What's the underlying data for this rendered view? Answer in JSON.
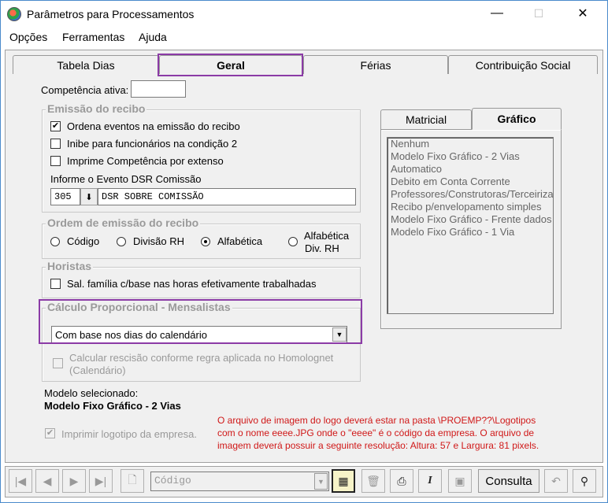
{
  "window": {
    "title": "Parâmetros para Processamentos",
    "min": "—",
    "max": "☐",
    "close": "✕"
  },
  "menu": [
    "Opções",
    "Ferramentas",
    "Ajuda"
  ],
  "tabs": [
    "Tabela Dias",
    "Geral",
    "Férias",
    "Contribuição Social"
  ],
  "active_tab": "Geral",
  "competencia": {
    "label": "Competência ativa:",
    "value": ""
  },
  "emissao": {
    "title": "Emissão do recibo",
    "options": [
      {
        "label": "Ordena eventos na emissão do recibo",
        "checked": true
      },
      {
        "label": "Inibe para funcionários na condição 2",
        "checked": false
      },
      {
        "label": "Imprime Competência por extenso",
        "checked": false
      }
    ],
    "dsr_label": "Informe o Evento DSR Comissão",
    "dsr_code": "305",
    "dsr_desc": "DSR SOBRE COMISSÃO"
  },
  "ordem": {
    "title": "Ordem de emissão do recibo",
    "options": [
      "Código",
      "Divisão RH",
      "Alfabética",
      "Alfabética",
      "Div. RH"
    ],
    "selected": "Alfabética"
  },
  "horistas": {
    "title": "Horistas",
    "option": "Sal. família c/base nas horas efetivamente trabalhadas",
    "checked": false
  },
  "calculo": {
    "title": "Cálculo Proporcional - Mensalistas",
    "selected": "Com base nos dias do calendário",
    "rescisao_line1": "Calcular rescisão conforme regra aplicada no Homolognet",
    "rescisao_line2": "(Calendário)"
  },
  "modelo": {
    "label": "Modelo selecionado:",
    "value": "Modelo Fixo Gráfico - 2 Vias"
  },
  "logotipo": {
    "label": "Imprimir logotipo da empresa.",
    "checked": true
  },
  "note": [
    "O arquivo de imagem do logo deverá estar na pasta \\PROEMP??\\Logotipos",
    "com o nome eeee.JPG onde o \"eeee\" é o código da empresa. O arquivo de",
    "imagem deverá possuir a seguinte resolução: Altura: 57 e Largura: 81 pixels."
  ],
  "side_tabs": [
    "Matricial",
    "Gráfico"
  ],
  "side_active": "Gráfico",
  "models": [
    "Nenhum",
    "Modelo Fixo Gráfico - 2 Vias",
    "Automatico",
    "Debito em Conta Corrente",
    "Professores/Construtoras/Terceiriza",
    "Recibo p/envelopamento simples",
    "Modelo Fixo Gráfico - Frente dados",
    "Modelo Fixo Gráfico - 1 Via"
  ],
  "toolbar": {
    "search_placeholder": "Código",
    "consulta": "Consulta"
  },
  "colors": {
    "highlight": "#8b3ba6",
    "note": "#d01818"
  }
}
